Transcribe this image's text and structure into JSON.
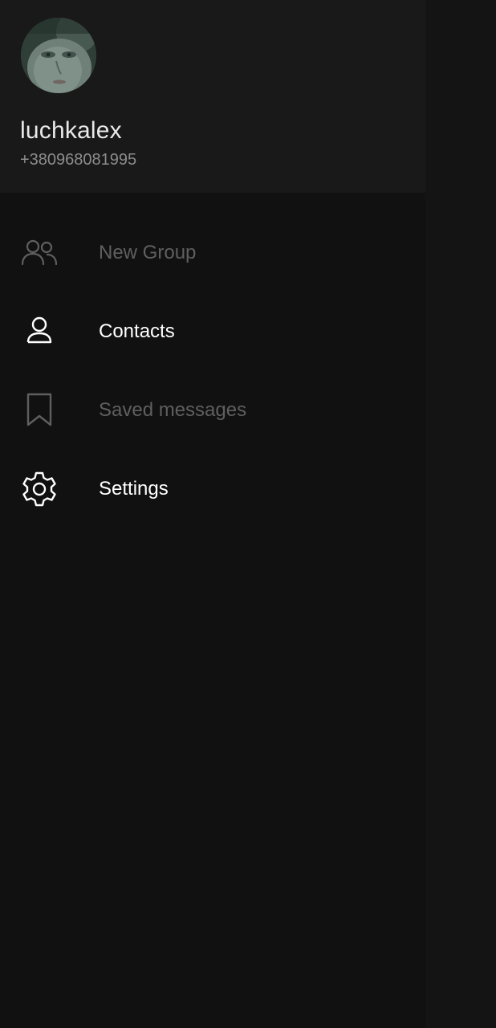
{
  "profile": {
    "username": "luchkalex",
    "phone": "+380968081995"
  },
  "menu": {
    "items": [
      {
        "label": "New Group",
        "icon": "group-icon",
        "enabled": false
      },
      {
        "label": "Contacts",
        "icon": "person-icon",
        "enabled": true
      },
      {
        "label": "Saved messages",
        "icon": "bookmark-icon",
        "enabled": false
      },
      {
        "label": "Settings",
        "icon": "gear-icon",
        "enabled": true
      }
    ]
  },
  "colors": {
    "drawer_bg": "#111111",
    "header_bg": "#191919",
    "text_active": "#ffffff",
    "text_disabled": "#5f5f5f",
    "phone_text": "#8d8d8d"
  }
}
